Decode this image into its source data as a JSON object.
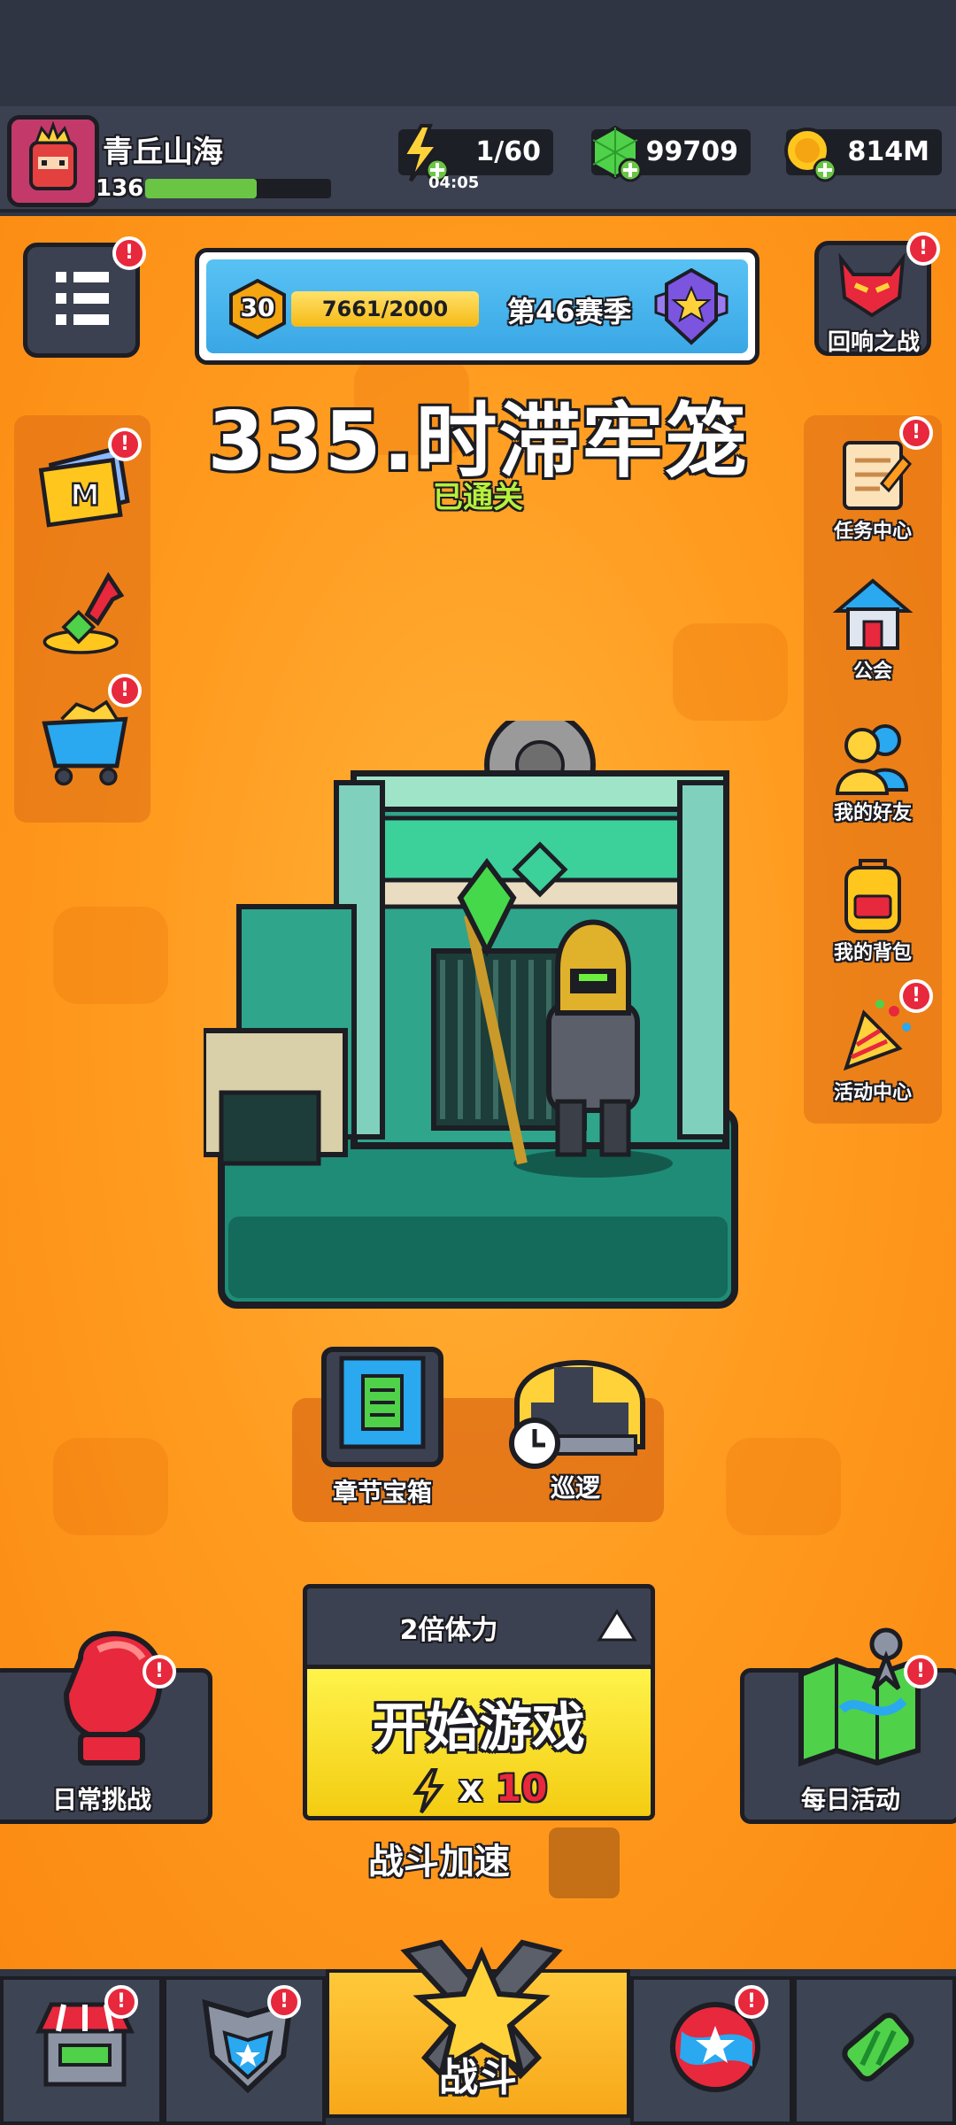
{
  "player": {
    "name": "青丘山海",
    "level": "136",
    "xp_fraction": 0.6
  },
  "resources": {
    "energy": "1/60",
    "energy_timer": "04:05",
    "gems": "99709",
    "gold": "814M"
  },
  "season": {
    "level": "30",
    "progress": "7661/2000",
    "progress_fraction": 1.0,
    "label": "第46赛季"
  },
  "stage": {
    "title": "335.时滞牢笼",
    "status": "已通关"
  },
  "right_menu": {
    "echo_battle": "回响之战",
    "quest_center": "任务中心",
    "guild": "公会",
    "friends": "我的好友",
    "backpack": "我的背包",
    "events": "活动中心"
  },
  "chest": {
    "chapter_chest": "章节宝箱",
    "patrol": "巡逻"
  },
  "play": {
    "boost_option": "2倍体力",
    "start_label": "开始游戏",
    "cost_prefix": "x",
    "cost_value": "10",
    "speed_label": "战斗加速"
  },
  "wings": {
    "daily_challenge": "日常挑战",
    "daily_activity": "每日活动"
  },
  "badges": {
    "mark": "!"
  },
  "bottom_nav": {
    "battle_label": "战斗"
  },
  "colors": {
    "main_orange": "#fb9a1c",
    "panel_dark": "#3b4150",
    "start_yellow": "#f7d21e",
    "badge_red": "#e8283c",
    "status_green": "#b6f03c"
  }
}
